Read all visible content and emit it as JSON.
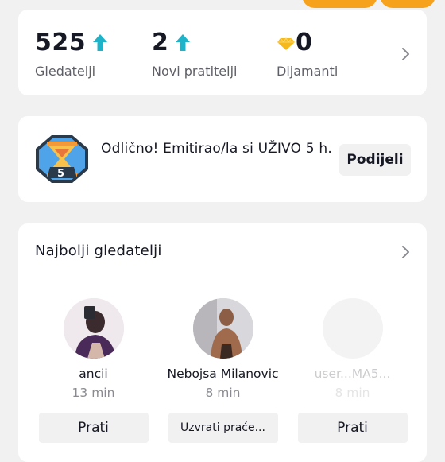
{
  "colors": {
    "accent_teal": "#1eb3c8",
    "diamond_gold": "#f5b91e",
    "banner_orange": "#f6a21d"
  },
  "stats": [
    {
      "value": "525",
      "label": "Gledatelji",
      "icon": "up-arrow-icon"
    },
    {
      "value": "2",
      "label": "Novi pratitelji",
      "icon": "up-arrow-icon"
    },
    {
      "value": "0",
      "label": "Dijamanti",
      "icon": "diamond-icon"
    }
  ],
  "achievement": {
    "badge_number": "5",
    "text": "Odlično! Emitirao/la si UŽIVO 5 h.",
    "share_label": "Podijeli"
  },
  "top_viewers": {
    "title": "Najbolji gledatelji",
    "viewers": [
      {
        "name": "ancii",
        "time": "13 min",
        "button": "Prati"
      },
      {
        "name": "Nebojsa Milanovic",
        "time": "8 min",
        "button": "Uzvrati praće..."
      },
      {
        "name": "user...MA5...",
        "time": "8 min",
        "button": "Prati"
      }
    ]
  }
}
